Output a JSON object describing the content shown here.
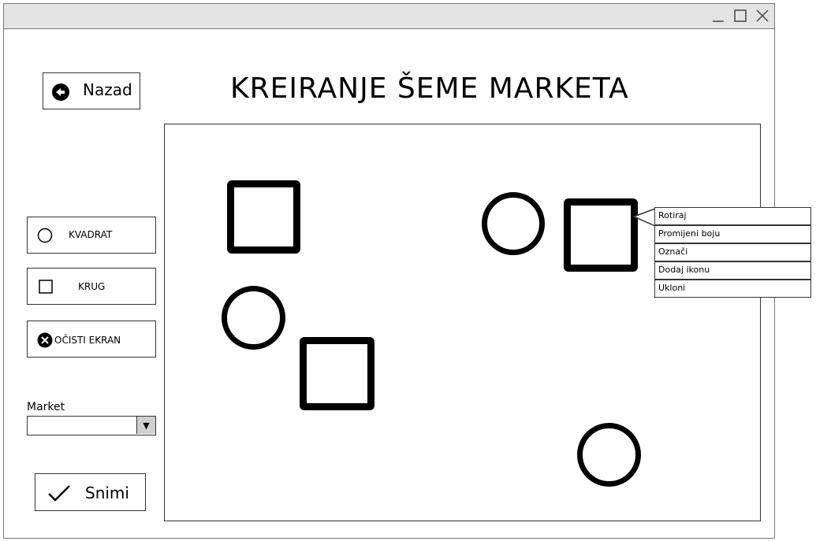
{
  "window": {
    "controls": [
      {
        "name": "minimize",
        "icon": "minimize-icon"
      },
      {
        "name": "maximize",
        "icon": "maximize-icon"
      },
      {
        "name": "close",
        "icon": "close-icon"
      }
    ]
  },
  "header": {
    "back_label": "Nazad",
    "back_icon": "arrow-left-circle-icon",
    "title": "KREIRANJE ŠEME MARKETA"
  },
  "toolbar": {
    "tools": [
      {
        "label": "KVADRAT",
        "icon": "circle-outline-icon"
      },
      {
        "label": "KRUG",
        "icon": "square-outline-icon"
      },
      {
        "label": "OČISTI EKRAN",
        "icon": "x-circle-icon"
      }
    ],
    "market_label": "Market",
    "market_value": "",
    "save_label": "Snimi",
    "save_icon": "checkmark-icon"
  },
  "canvas": {
    "shapes": [
      {
        "type": "square"
      },
      {
        "type": "circle"
      },
      {
        "type": "square"
      },
      {
        "type": "circle"
      },
      {
        "type": "square"
      },
      {
        "type": "circle"
      }
    ]
  },
  "context_menu": {
    "items": [
      "Rotiraj",
      "Promijeni boju",
      "Označi",
      "Dodaj ikonu",
      "Ukloni"
    ]
  },
  "colors": {
    "titlebar_bg": "#e4e4e4",
    "border": "#333333",
    "shape_stroke": "#000000",
    "dropdown_arrow_bg": "#cfcfcf"
  }
}
